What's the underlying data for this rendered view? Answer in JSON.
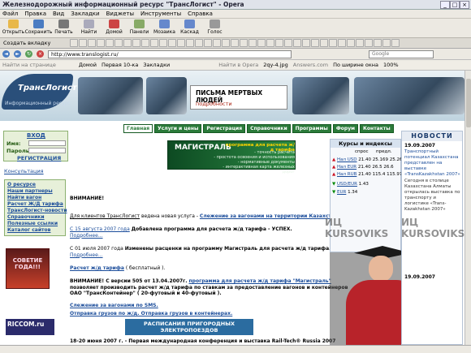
{
  "window": {
    "title": "Железнодорожный информационный ресурс \"ТрансЛогист\" - Opera"
  },
  "menu": [
    "Файл",
    "Правка",
    "Вид",
    "Закладки",
    "Виджеты",
    "Инструменты",
    "Справка"
  ],
  "toolbar": [
    {
      "label": "Открыть",
      "color": "#e8b84a"
    },
    {
      "label": "Сохранить",
      "color": "#4a7cc2"
    },
    {
      "label": "Печать",
      "color": "#777"
    },
    {
      "label": "Найти",
      "color": "#aab"
    },
    {
      "label": "Домой",
      "color": "#c44"
    },
    {
      "label": "Панели",
      "color": "#8a6"
    },
    {
      "label": "Мозаика",
      "color": "#68c"
    },
    {
      "label": "Каскад",
      "color": "#68c"
    },
    {
      "label": "Голос",
      "color": "#999"
    }
  ],
  "tabbar": {
    "new_tab": "Создать вкладку"
  },
  "nav": {
    "address": "http://www.translogist.ru/",
    "search_engine": "Google"
  },
  "bookmarks": [
    "Найти на странице",
    "Домой",
    "Первая 10-ка",
    "Закладки",
    "Найти в Opera",
    "2qy-4.jpg",
    "Answers.com",
    "По ширине окна",
    "100%"
  ],
  "site": {
    "logo": "ТрансЛогист",
    "logo_sub": "Информационный ресурс",
    "ad_title": "ПИСЬМА МЕРТВЫХ ЛЮДЕЙ",
    "ad_sub": "подробности",
    "tabs": [
      "Главная",
      "Услуги и цены",
      "Регистрация",
      "Справочники",
      "Программы",
      "Форум",
      "Контакты"
    ],
    "login": {
      "header": "ВХОД",
      "user_label": "Имя:",
      "pass_label": "Пароль:",
      "register": "РЕГИСТРАЦИЯ"
    },
    "consult": "Консультация",
    "menu_items": [
      "О ресурсе",
      "Наши партнеры",
      "Найти вагон",
      "Расчет Ж/Д тарифа",
      "ТрансЛогист-новости",
      "Справочники",
      "Полезные ссылки",
      "Каталог сайтов"
    ],
    "left_ad": "СОВЕТИЕ ГОДА!!!",
    "riccom": "RICCOM.ru",
    "mag_title": "МАГИСТРАЛЬ",
    "mag_sub": "программа для расчета ж/д тарифа",
    "mag_lines": [
      "- точность расчета",
      "- простота освоения и использования",
      "- нормативные документы",
      "- интерактивная карта железных дорог"
    ],
    "attention": "ВНИМАНИЕ!",
    "p1_pre": "Для клиентов ТрансЛогист",
    "p1_mid": "ведена новая услуга -",
    "p1_link": "Слежение за вагонами на территории Казахстана.",
    "p2_date": "С 15 августа 2007 года",
    "p2_text": "Добавлена программа для расчета ж/д тарифа - УСПЕХ.",
    "p2_more": "Подробнее...",
    "p3_date": "С 01 июля 2007 года",
    "p3_text": "Изменены расценки на программу Магистраль для расчета ж/д тарифа.",
    "p3_more": "Подробнее...",
    "p4_link": "Расчет ж/д тарифа",
    "p4_text": "( бесплатный ).",
    "p5_a": "ВНИМАНИЕ! С версии 505 от 13.04.2007г.",
    "p5_link": "программа для расчета ж/д тарифа \"Магистраль\"",
    "p5_b": "позволяет производить расчет ж/д тарифа по ставкам за предоставление вагонов и контейнеров",
    "p5_c": "ОАО \"ТрансКонтейнер\" ( 20-футовый и 40-футовый ).",
    "p6_link": "Слежение за вагонами по SMS.",
    "p7_link": "Отправка грузов по ж/д. Отправка грузов в контейнерах.",
    "rasp": "РАСПИСАНИЯ ПРИГОРОДНЫХ ЭЛЕКТРОПОЕЗДОВ",
    "bottom_news": "18-20 июня 2007 г. - Первая международная конференция и выставка Rail-Tech® Russia 2007"
  },
  "rates": {
    "header": "Курсы и индексы",
    "cols": [
      "спрос",
      "предл."
    ],
    "rows": [
      {
        "name": "Нал USD",
        "v1": "21.40",
        "v2": "25.169",
        "v3": "25.269",
        "dir": "up"
      },
      {
        "name": "Нал EUR",
        "v1": "21.40",
        "v2": "26.5",
        "v3": "26.6",
        "dir": "up"
      },
      {
        "name": "Нал RUB",
        "v1": "21.40",
        "v2": "115.4",
        "v3": "115.97",
        "dir": "up"
      },
      {
        "name": "USD/EUR",
        "v1": "",
        "v2": "1.43",
        "v3": "",
        "dir": "down"
      },
      {
        "name": "EUR",
        "v1": "",
        "v2": "1.34",
        "v3": "",
        "dir": "down"
      }
    ]
  },
  "news": {
    "header": "НОВОСТИ",
    "items": [
      {
        "date": "19.09.2007",
        "text": "Транспортный потенциал Казахстана представлен на выставке «TransKazakhstan 2007»"
      },
      {
        "date": "",
        "text": "Сегодня в столице Казахстана Алматы открылась выставка по транспорту и логистике «Trans-Kazakhstan 2007»"
      },
      {
        "date": "19.09.2007",
        "text": ""
      }
    ]
  },
  "watermarks": [
    "ИЦ KURSOVIKS",
    "ИЦ KURSOVIKS"
  ]
}
